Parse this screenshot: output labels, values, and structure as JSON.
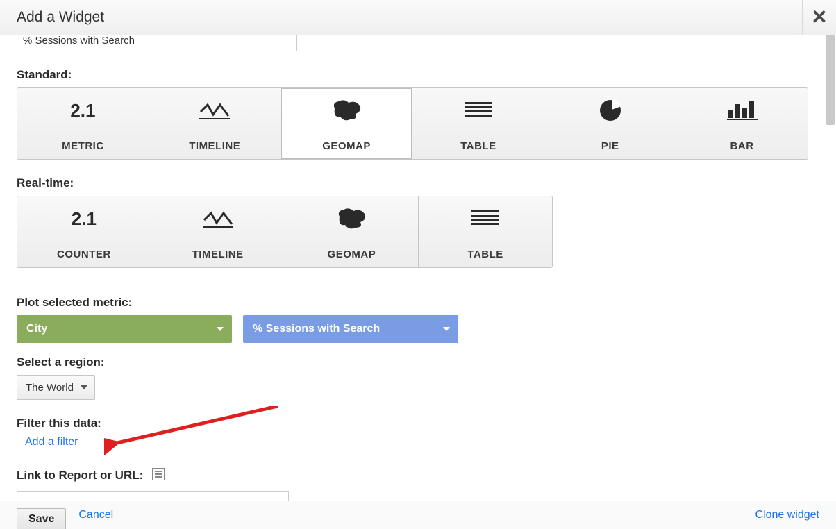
{
  "dialog": {
    "title": "Add a Widget",
    "close_glyph": "✕"
  },
  "top_field_value": "% Sessions with Search",
  "labels": {
    "standard": "Standard:",
    "realtime": "Real-time:",
    "plot_metric": "Plot selected metric:",
    "select_region": "Select a region:",
    "filter_data": "Filter this data:",
    "link_report": "Link to Report or URL:"
  },
  "standard_cards": [
    {
      "id": "metric",
      "label": "METRIC",
      "num": "2.1"
    },
    {
      "id": "timeline",
      "label": "TIMELINE"
    },
    {
      "id": "geomap",
      "label": "GEOMAP",
      "selected": true
    },
    {
      "id": "table",
      "label": "TABLE"
    },
    {
      "id": "pie",
      "label": "PIE"
    },
    {
      "id": "bar",
      "label": "BAR"
    }
  ],
  "realtime_cards": [
    {
      "id": "counter",
      "label": "COUNTER",
      "num": "2.1"
    },
    {
      "id": "timeline",
      "label": "TIMELINE"
    },
    {
      "id": "geomap",
      "label": "GEOMAP"
    },
    {
      "id": "table",
      "label": "TABLE"
    }
  ],
  "dimension_pill": "City",
  "metric_pill": "% Sessions with Search",
  "region_select": "The World",
  "add_filter_link": "Add a filter",
  "url_value": "",
  "footer": {
    "save": "Save",
    "cancel": "Cancel",
    "clone": "Clone widget"
  }
}
